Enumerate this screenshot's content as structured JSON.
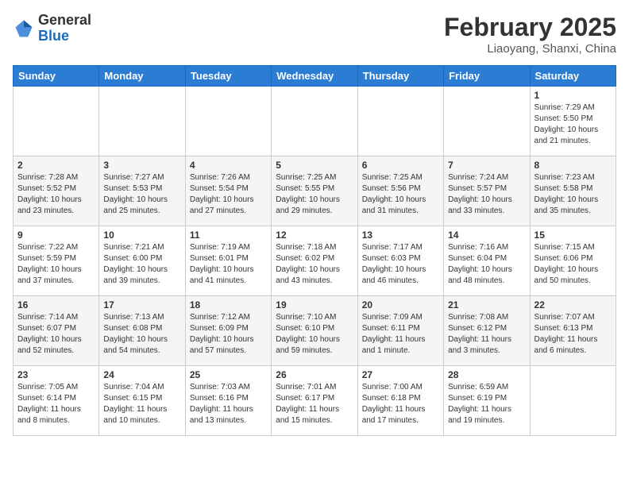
{
  "header": {
    "logo_general": "General",
    "logo_blue": "Blue",
    "month_year": "February 2025",
    "location": "Liaoyang, Shanxi, China"
  },
  "weekdays": [
    "Sunday",
    "Monday",
    "Tuesday",
    "Wednesday",
    "Thursday",
    "Friday",
    "Saturday"
  ],
  "weeks": [
    [
      null,
      null,
      null,
      null,
      null,
      null,
      {
        "day": "1",
        "sunrise": "7:29 AM",
        "sunset": "5:50 PM",
        "daylight": "10 hours and 21 minutes."
      }
    ],
    [
      {
        "day": "2",
        "sunrise": "7:28 AM",
        "sunset": "5:52 PM",
        "daylight": "10 hours and 23 minutes."
      },
      {
        "day": "3",
        "sunrise": "7:27 AM",
        "sunset": "5:53 PM",
        "daylight": "10 hours and 25 minutes."
      },
      {
        "day": "4",
        "sunrise": "7:26 AM",
        "sunset": "5:54 PM",
        "daylight": "10 hours and 27 minutes."
      },
      {
        "day": "5",
        "sunrise": "7:25 AM",
        "sunset": "5:55 PM",
        "daylight": "10 hours and 29 minutes."
      },
      {
        "day": "6",
        "sunrise": "7:25 AM",
        "sunset": "5:56 PM",
        "daylight": "10 hours and 31 minutes."
      },
      {
        "day": "7",
        "sunrise": "7:24 AM",
        "sunset": "5:57 PM",
        "daylight": "10 hours and 33 minutes."
      },
      {
        "day": "8",
        "sunrise": "7:23 AM",
        "sunset": "5:58 PM",
        "daylight": "10 hours and 35 minutes."
      }
    ],
    [
      {
        "day": "9",
        "sunrise": "7:22 AM",
        "sunset": "5:59 PM",
        "daylight": "10 hours and 37 minutes."
      },
      {
        "day": "10",
        "sunrise": "7:21 AM",
        "sunset": "6:00 PM",
        "daylight": "10 hours and 39 minutes."
      },
      {
        "day": "11",
        "sunrise": "7:19 AM",
        "sunset": "6:01 PM",
        "daylight": "10 hours and 41 minutes."
      },
      {
        "day": "12",
        "sunrise": "7:18 AM",
        "sunset": "6:02 PM",
        "daylight": "10 hours and 43 minutes."
      },
      {
        "day": "13",
        "sunrise": "7:17 AM",
        "sunset": "6:03 PM",
        "daylight": "10 hours and 46 minutes."
      },
      {
        "day": "14",
        "sunrise": "7:16 AM",
        "sunset": "6:04 PM",
        "daylight": "10 hours and 48 minutes."
      },
      {
        "day": "15",
        "sunrise": "7:15 AM",
        "sunset": "6:06 PM",
        "daylight": "10 hours and 50 minutes."
      }
    ],
    [
      {
        "day": "16",
        "sunrise": "7:14 AM",
        "sunset": "6:07 PM",
        "daylight": "10 hours and 52 minutes."
      },
      {
        "day": "17",
        "sunrise": "7:13 AM",
        "sunset": "6:08 PM",
        "daylight": "10 hours and 54 minutes."
      },
      {
        "day": "18",
        "sunrise": "7:12 AM",
        "sunset": "6:09 PM",
        "daylight": "10 hours and 57 minutes."
      },
      {
        "day": "19",
        "sunrise": "7:10 AM",
        "sunset": "6:10 PM",
        "daylight": "10 hours and 59 minutes."
      },
      {
        "day": "20",
        "sunrise": "7:09 AM",
        "sunset": "6:11 PM",
        "daylight": "11 hours and 1 minute."
      },
      {
        "day": "21",
        "sunrise": "7:08 AM",
        "sunset": "6:12 PM",
        "daylight": "11 hours and 3 minutes."
      },
      {
        "day": "22",
        "sunrise": "7:07 AM",
        "sunset": "6:13 PM",
        "daylight": "11 hours and 6 minutes."
      }
    ],
    [
      {
        "day": "23",
        "sunrise": "7:05 AM",
        "sunset": "6:14 PM",
        "daylight": "11 hours and 8 minutes."
      },
      {
        "day": "24",
        "sunrise": "7:04 AM",
        "sunset": "6:15 PM",
        "daylight": "11 hours and 10 minutes."
      },
      {
        "day": "25",
        "sunrise": "7:03 AM",
        "sunset": "6:16 PM",
        "daylight": "11 hours and 13 minutes."
      },
      {
        "day": "26",
        "sunrise": "7:01 AM",
        "sunset": "6:17 PM",
        "daylight": "11 hours and 15 minutes."
      },
      {
        "day": "27",
        "sunrise": "7:00 AM",
        "sunset": "6:18 PM",
        "daylight": "11 hours and 17 minutes."
      },
      {
        "day": "28",
        "sunrise": "6:59 AM",
        "sunset": "6:19 PM",
        "daylight": "11 hours and 19 minutes."
      },
      null
    ]
  ]
}
